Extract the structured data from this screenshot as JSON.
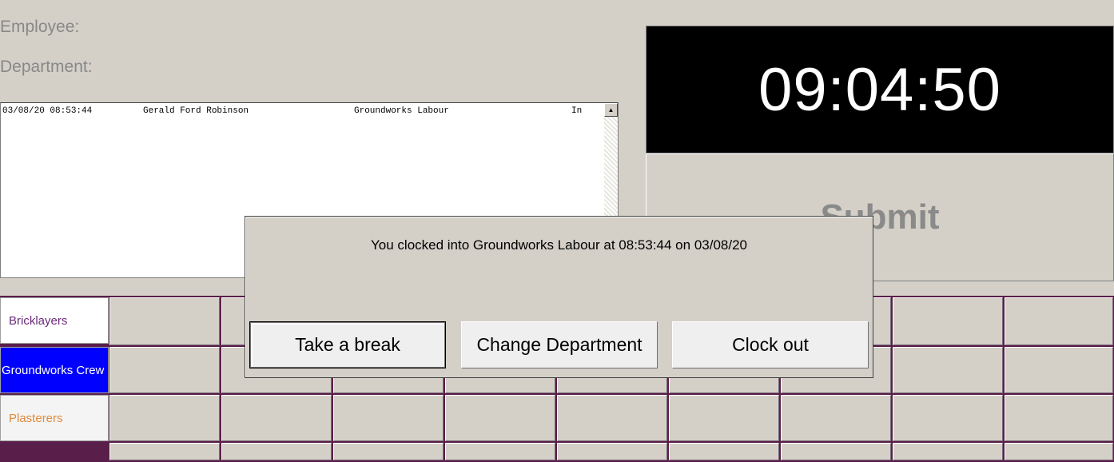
{
  "form": {
    "employee_label": "Employee:",
    "department_label": "Department:"
  },
  "log": {
    "rows": [
      {
        "timestamp": "03/08/20 08:53:44",
        "employee": "Gerald Ford Robinson",
        "department": "Groundworks Labour",
        "status": "In"
      }
    ],
    "scroll_up_icon": "▲"
  },
  "clock": {
    "time": "09:04:50"
  },
  "submit": {
    "label": "Submit"
  },
  "departments": [
    {
      "label": "Bricklayers",
      "text_color": "#6b2a7a",
      "bg_color": "#ffffff"
    },
    {
      "label": "Groundworks Crew",
      "text_color": "#ffffff",
      "bg_color": "#0000ff"
    },
    {
      "label": "Plasterers",
      "text_color": "#e08a3c",
      "bg_color": "#f4f4f4"
    }
  ],
  "dialog": {
    "message": "You clocked into Groundworks Labour at 08:53:44 on 03/08/20",
    "buttons": {
      "take_break": "Take a break",
      "change_department": "Change Department",
      "clock_out": "Clock out"
    }
  },
  "colors": {
    "background": "#d4d0c8",
    "clock_bg": "#000000",
    "grid_line": "#5a1e4a",
    "selected_department": "#0000ff"
  }
}
